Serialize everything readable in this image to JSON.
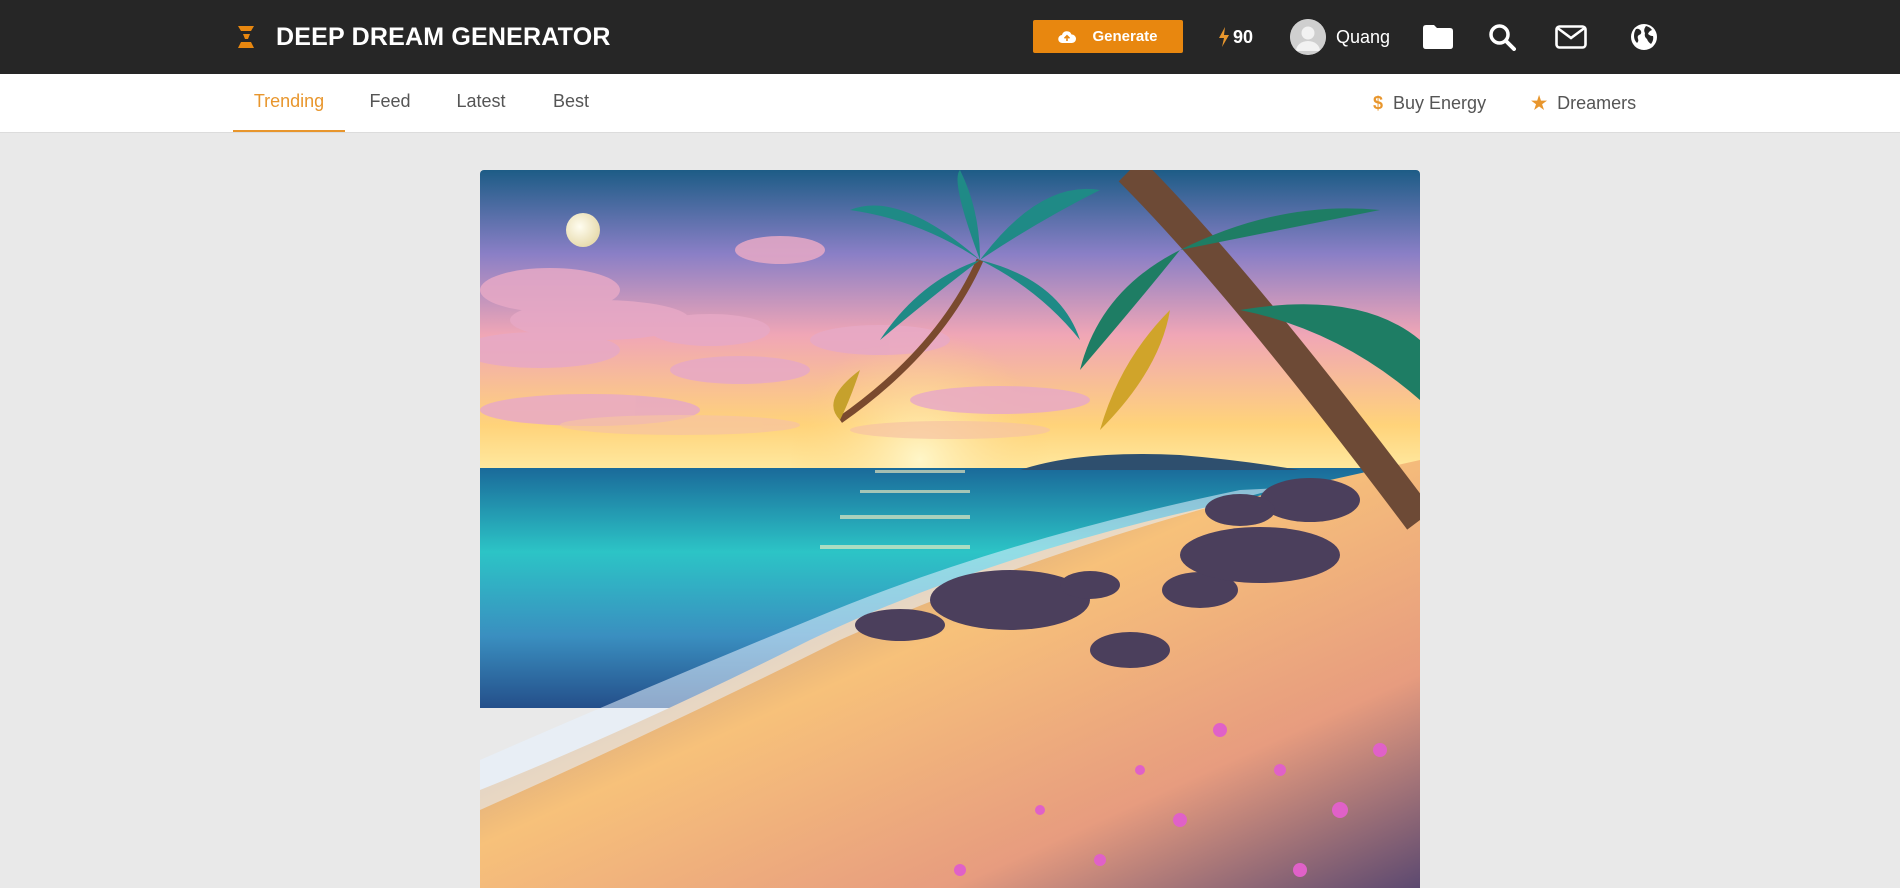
{
  "header": {
    "brand": "DEEP DREAM GENERATOR",
    "generate_label": "Generate",
    "energy_value": "90",
    "username": "Quang",
    "icons": [
      "logo-icon",
      "cloud-upload-icon",
      "bolt-icon",
      "avatar",
      "folder-icon",
      "search-icon",
      "mail-icon",
      "globe-icon"
    ]
  },
  "subnav": {
    "tabs": [
      {
        "label": "Trending",
        "active": true
      },
      {
        "label": "Feed",
        "active": false
      },
      {
        "label": "Latest",
        "active": false
      },
      {
        "label": "Best",
        "active": false
      }
    ],
    "right_links": [
      {
        "label": "Buy Energy",
        "icon": "dollar-icon"
      },
      {
        "label": "Dreamers",
        "icon": "star-icon"
      }
    ]
  },
  "main": {
    "artwork": "tropical beach at sunset with palm trees, rocks, moon and pink flowers"
  },
  "colors": {
    "topbar_bg": "#262626",
    "accent": "#e8870f",
    "active_tab": "#e8962d",
    "page_bg": "#e9e9e9"
  }
}
